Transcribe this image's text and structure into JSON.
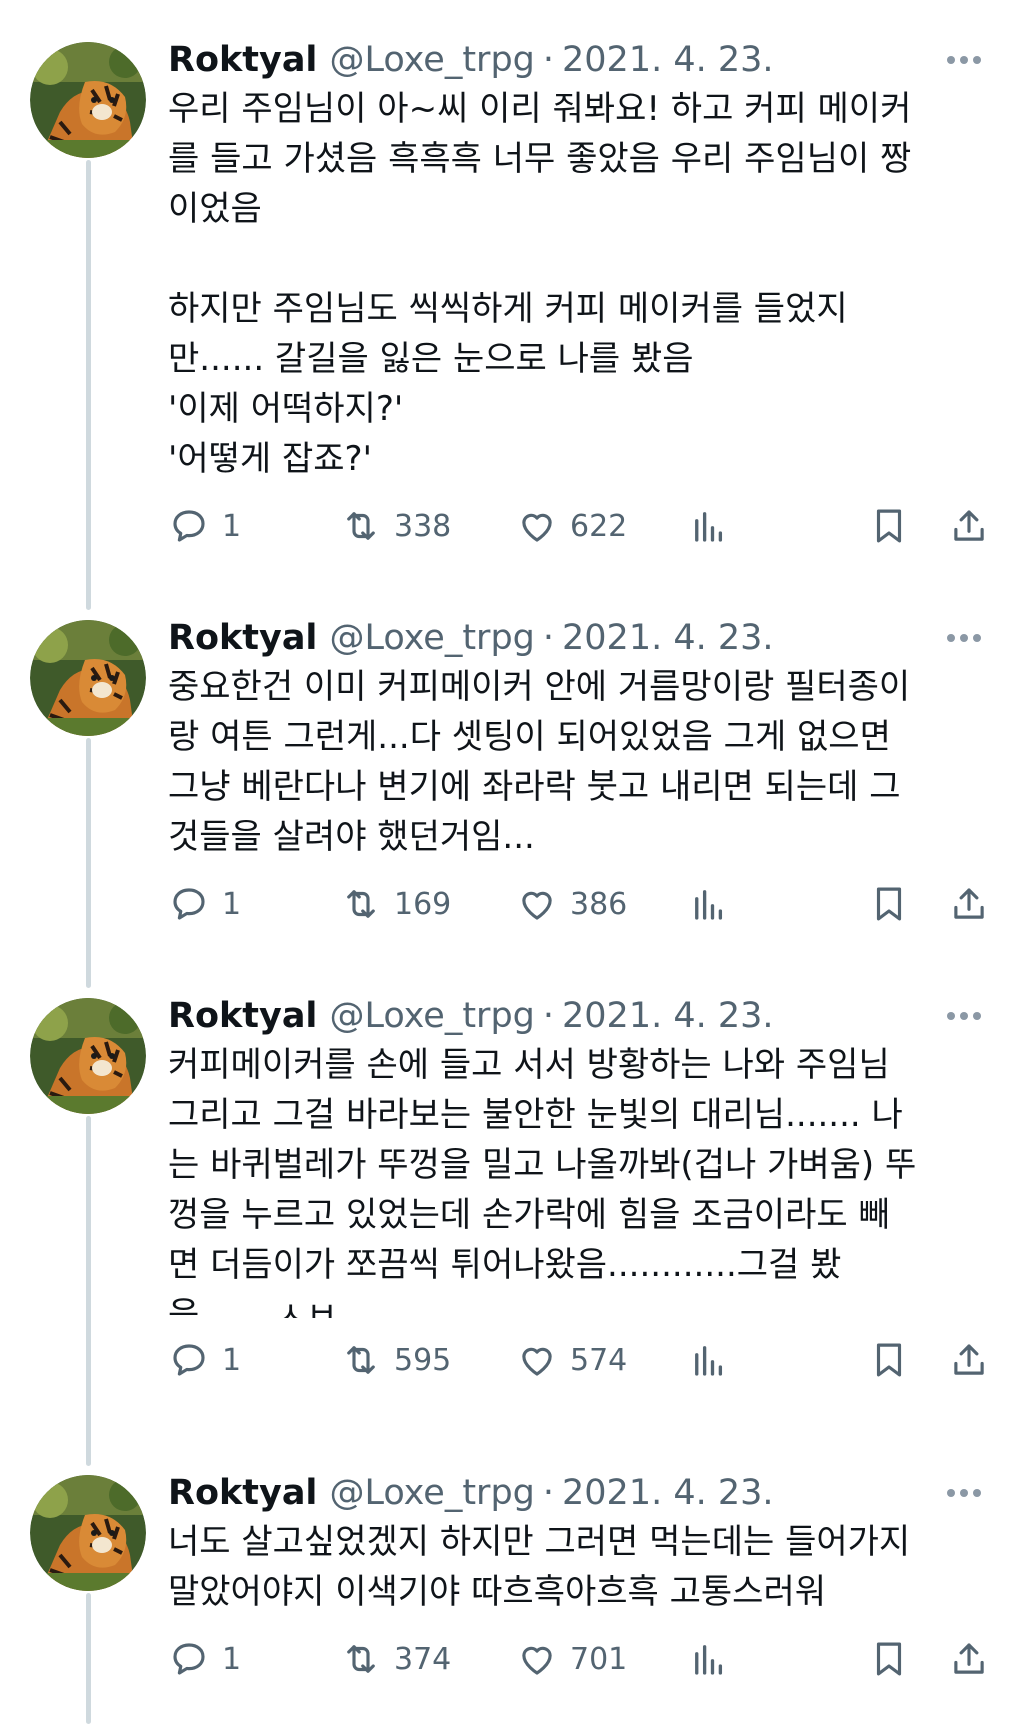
{
  "tweets": [
    {
      "name": "Roktyal",
      "handle": "@Loxe_trpg",
      "separator": "·",
      "date": "2021. 4. 23.",
      "text": "우리 주임님이 아~씨 이리 줘봐요! 하고 커피 메이커\n를 들고 가셨음 흑흑흑 너무 좋았음 우리 주임님이 짱\n이었음\n\n하지만 주임님도 씩씩하게 커피 메이커를 들었지\n만...... 갈길을 잃은 눈으로 나를 봤음\n'이제 어떡하지?'\n'어떻게 잡죠?'",
      "replies": "1",
      "retweets": "338",
      "likes": "622"
    },
    {
      "name": "Roktyal",
      "handle": "@Loxe_trpg",
      "separator": "·",
      "date": "2021. 4. 23.",
      "text": "중요한건 이미 커피메이커 안에 거름망이랑 필터종이\n랑 여튼 그런게...다 셋팅이 되어있었음 그게 없으면\n그냥 베란다나 변기에 좌라락 붓고 내리면 되는데 그\n것들을 살려야 했던거임...",
      "replies": "1",
      "retweets": "169",
      "likes": "386"
    },
    {
      "name": "Roktyal",
      "handle": "@Loxe_trpg",
      "separator": "·",
      "date": "2021. 4. 23.",
      "text": "커피메이커를 손에 들고 서서 방황하는 나와 주임님\n그리고 그걸 바라보는 불안한 눈빛의 대리님....... 나\n는 바퀴벌레가 뚜껑을 밀고 나올까봐(겁나 가벼움) 뚜\n껑을 누르고 있었는데 손가락에 힘을 조금이라도 빼\n면 더듬이가 쪼끔씩 튀어나왔음............그걸 봤",
      "text_cut": "음...... ㅅㅂ",
      "replies": "1",
      "retweets": "595",
      "likes": "574"
    },
    {
      "name": "Roktyal",
      "handle": "@Loxe_trpg",
      "separator": "·",
      "date": "2021. 4. 23.",
      "text": "너도 살고싶었겠지 하지만 그러면 먹는데는 들어가지\n말았어야지 이색기야 따흐흑아흐흑 고통스러워",
      "replies": "1",
      "retweets": "374",
      "likes": "701"
    }
  ],
  "icons": {
    "avatar": "tiger-avatar",
    "more": "more-dots-icon",
    "reply": "reply-icon",
    "retweet": "retweet-icon",
    "like": "heart-icon",
    "views": "views-icon",
    "bookmark": "bookmark-icon",
    "share": "share-icon"
  },
  "colors": {
    "text": "#0f1419",
    "secondary": "#536471",
    "thread_line": "#cfd9de",
    "background": "#ffffff"
  }
}
